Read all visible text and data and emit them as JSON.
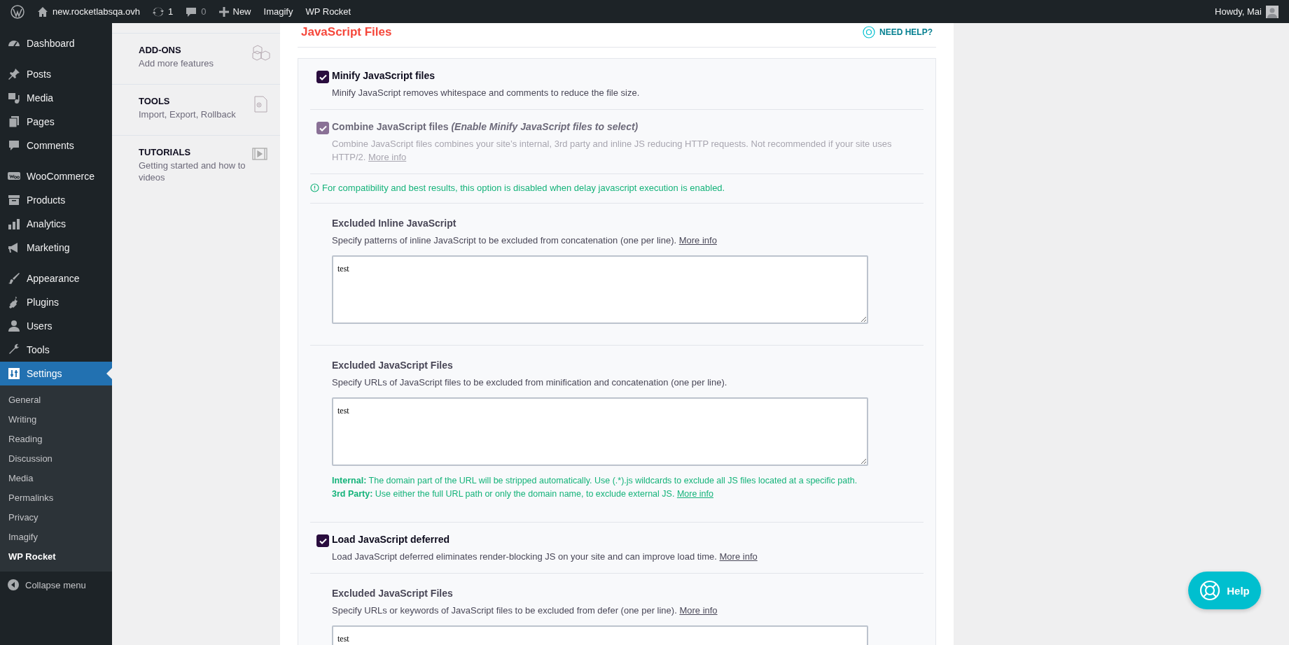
{
  "admin_bar": {
    "site": "new.rocketlabsqa.ovh",
    "updates": "1",
    "comments": "0",
    "new": "New",
    "links": [
      "Imagify",
      "WP Rocket"
    ],
    "greeting": "Howdy, Mai"
  },
  "sidebar": {
    "groups": [
      {
        "items": [
          {
            "label": "Dashboard",
            "selected": false
          }
        ]
      },
      {
        "items": [
          {
            "label": "Posts",
            "selected": false
          },
          {
            "label": "Media",
            "selected": false
          },
          {
            "label": "Pages",
            "selected": false
          },
          {
            "label": "Comments",
            "selected": false
          }
        ]
      },
      {
        "items": [
          {
            "label": "WooCommerce",
            "selected": false
          },
          {
            "label": "Products",
            "selected": false
          },
          {
            "label": "Analytics",
            "selected": false
          },
          {
            "label": "Marketing",
            "selected": false
          }
        ]
      },
      {
        "items": [
          {
            "label": "Appearance",
            "selected": false
          },
          {
            "label": "Plugins",
            "selected": false
          },
          {
            "label": "Users",
            "selected": false
          },
          {
            "label": "Tools",
            "selected": false
          },
          {
            "label": "Settings",
            "selected": true
          }
        ]
      }
    ],
    "submenu": [
      {
        "label": "General",
        "selected": false
      },
      {
        "label": "Writing",
        "selected": false
      },
      {
        "label": "Reading",
        "selected": false
      },
      {
        "label": "Discussion",
        "selected": false
      },
      {
        "label": "Media",
        "selected": false
      },
      {
        "label": "Permalinks",
        "selected": false
      },
      {
        "label": "Privacy",
        "selected": false
      },
      {
        "label": "Imagify",
        "selected": false
      },
      {
        "label": "WP Rocket",
        "selected": true
      }
    ],
    "collapse": "Collapse menu"
  },
  "rocket_nav": [
    {
      "title": "ADD-ONS",
      "subtitle": "Add more features"
    },
    {
      "title": "TOOLS",
      "subtitle": "Import, Export, Rollback"
    },
    {
      "title": "TUTORIALS",
      "subtitle": "Getting started and how to videos"
    }
  ],
  "section": {
    "title": "JavaScript Files",
    "help": "NEED HELP?"
  },
  "options": [
    {
      "kind": "checkbox",
      "title": "Minify JavaScript files",
      "description": "Minify JavaScript removes whitespace and comments to reduce the file size.",
      "checked": true,
      "disabled": false
    },
    {
      "kind": "checkbox",
      "title": "Combine JavaScript files",
      "title_note": "(Enable Minify JavaScript files to select)",
      "description": "Combine JavaScript files combines your site’s internal, 3rd party and inline JS reducing HTTP requests. Not recommended if your site uses HTTP/2.",
      "link": "More info",
      "checked": true,
      "disabled": true
    },
    {
      "kind": "notice",
      "text": "For compatibility and best results, this option is disabled when delay javascript execution is enabled."
    },
    {
      "kind": "textarea",
      "title": "Excluded Inline JavaScript",
      "description": "Specify patterns of inline JavaScript to be excluded from concatenation (one per line).",
      "link": "More info",
      "value": "test"
    },
    {
      "kind": "textarea",
      "title": "Excluded JavaScript Files",
      "description": "Specify URLs of JavaScript files to be excluded from minification and concatenation (one per line).",
      "value": "test",
      "notes": [
        {
          "text": "**Internal:** The domain part of the URL will be stripped automatically. Use (.*).js wildcards to exclude all JS files located at a specific path."
        },
        {
          "text": "**3rd Party:** Use either the full URL path or only the domain name, to exclude external JS.",
          "link": "More info"
        }
      ]
    },
    {
      "kind": "checkbox",
      "title": "Load JavaScript deferred",
      "description": "Load JavaScript deferred eliminates render-blocking JS on your site and can improve load time.",
      "link": "More info",
      "checked": true,
      "disabled": false
    },
    {
      "kind": "textarea",
      "title": "Excluded JavaScript Files",
      "description": "Specify URLs or keywords of JavaScript files to be excluded from defer (one per line).",
      "link": "More info",
      "value": "test"
    }
  ],
  "help_button": "Help"
}
